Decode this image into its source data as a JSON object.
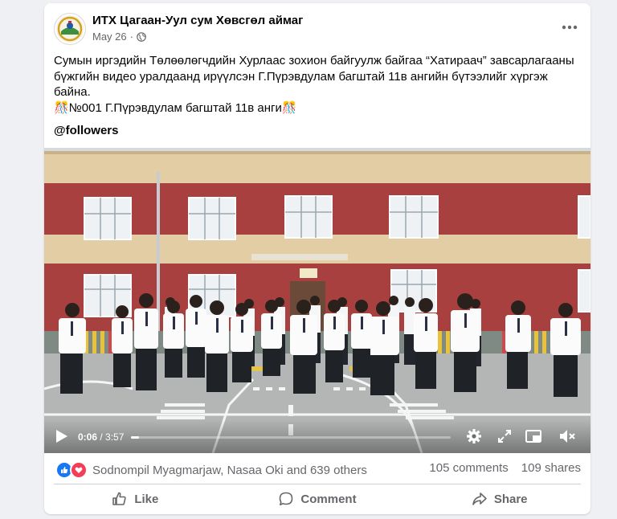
{
  "post": {
    "page_name": "ИТХ Цагаан-Уул сум Хөвсгөл аймаг",
    "date": "May 26",
    "separator": "·",
    "text_line1": "Сумын иргэдийн Төлөөлөгчдийн Хурлаас зохион байгуулж байгаа  “Хатираач” завсарлагааны",
    "text_line2": "бүжгийн  видео уралдаанд ирүүлсэн Г.Пүрэвдулам багштай 11в ангийн бүтээлийг хүргэж",
    "text_line3": "байна.",
    "text_line4": "🎊№001 Г.Пүрэвдулам багштай 11в анги🎊",
    "hashtag": "@followers"
  },
  "video": {
    "current_time": "0:06",
    "separator": " / ",
    "total_time": "3:57",
    "progress_fraction": 0.025
  },
  "stats": {
    "reaction_names": "Sodnompil Myagmarjaw, Nasaa Oki and 639 others",
    "comments": "105 comments",
    "shares": "109 shares"
  },
  "actions": {
    "like": "Like",
    "comment": "Comment",
    "share": "Share"
  },
  "colors": {
    "accent": "#1877f2",
    "love": "#f33e58",
    "muted_text": "#65676b",
    "building_red": "#a8403f",
    "building_cream": "#e3cda4"
  },
  "icons": [
    "globe-icon",
    "more-horizontal-icon",
    "play-icon",
    "settings-gear-icon",
    "fullscreen-icon",
    "picture-in-picture-icon",
    "mute-icon",
    "like-reaction-icon",
    "love-reaction-icon",
    "thumbs-up-icon",
    "comment-icon",
    "share-icon"
  ]
}
